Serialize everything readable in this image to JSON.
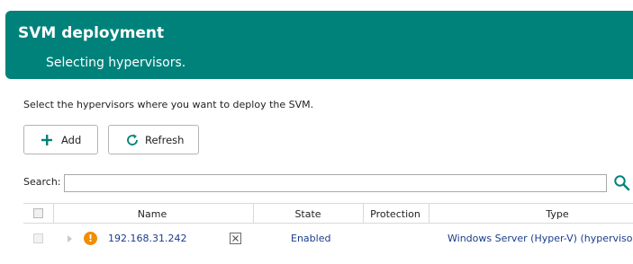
{
  "header": {
    "title": "SVM deployment",
    "subtitle": "Selecting hypervisors."
  },
  "instruction": "Select the hypervisors where you want to deploy the SVM.",
  "toolbar": {
    "add_label": "Add",
    "refresh_label": "Refresh"
  },
  "search": {
    "label": "Search:",
    "value": "",
    "placeholder": ""
  },
  "grid": {
    "columns": {
      "name": "Name",
      "state": "State",
      "protection": "Protection",
      "type": "Type"
    },
    "rows": [
      {
        "name": "192.168.31.242",
        "state": "Enabled",
        "protection": "",
        "type": "Windows Server (Hyper-V) (hypervisor a",
        "status_icon": "warning-icon",
        "checked": false
      }
    ]
  },
  "colors": {
    "header_bg": "#00827b",
    "accent": "#00827b",
    "link_text": "#1a3c8c",
    "warning": "#f28c00"
  },
  "icons": {
    "add": "plus-icon",
    "refresh": "refresh-icon",
    "search": "search-icon",
    "expand": "chevron-right-icon",
    "status": "warning-icon",
    "remove": "remove-icon"
  }
}
